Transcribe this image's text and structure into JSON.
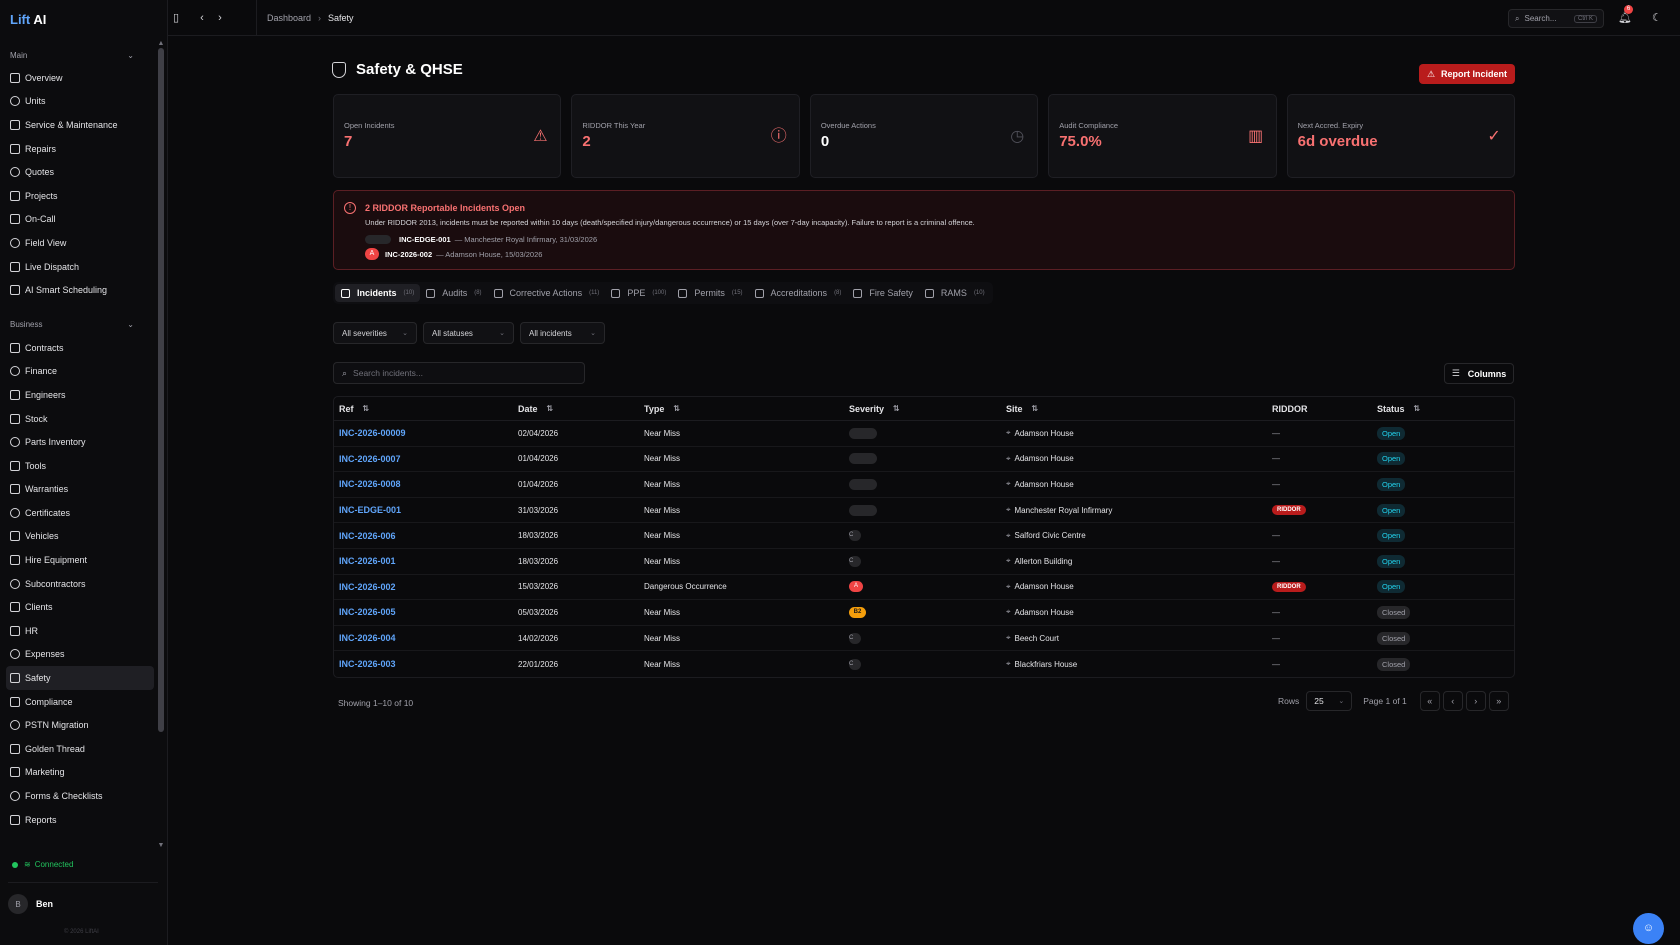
{
  "app": {
    "logo_a": "Lift",
    "logo_b": " AI"
  },
  "sidebar": {
    "main_section": "Main",
    "main_items": [
      "Overview",
      "Units",
      "Service & Maintenance",
      "Repairs",
      "Quotes",
      "Projects",
      "On-Call",
      "Field View",
      "Live Dispatch",
      "AI Smart Scheduling"
    ],
    "business_section": "Business",
    "business_items": [
      "Contracts",
      "Finance",
      "Engineers",
      "Stock",
      "Parts Inventory",
      "Tools",
      "Warranties",
      "Certificates",
      "Vehicles",
      "Hire Equipment",
      "Subcontractors",
      "Clients",
      "HR",
      "Expenses",
      "Safety",
      "Compliance",
      "PSTN Migration",
      "Golden Thread",
      "Marketing",
      "Forms & Checklists",
      "Reports"
    ],
    "active_item": "Safety",
    "connection": "Connected",
    "user_initial": "B",
    "user_name": "Ben",
    "copyright": "© 2026 LiftAI"
  },
  "topbar": {
    "breadcrumb_root": "Dashboard",
    "breadcrumb_current": "Safety",
    "search_placeholder": "Search...",
    "search_shortcut": "Ctrl K",
    "notification_count": "6"
  },
  "page": {
    "title": "Safety & QHSE",
    "report_button": "Report Incident"
  },
  "stats": [
    {
      "label": "Open Incidents",
      "value": "7",
      "accent": true,
      "icon": "warning-triangle-icon"
    },
    {
      "label": "RIDDOR This Year",
      "value": "2",
      "accent": true,
      "icon": "alert-circle-icon"
    },
    {
      "label": "Overdue Actions",
      "value": "0",
      "accent": false,
      "icon": "clock-icon"
    },
    {
      "label": "Audit Compliance",
      "value": "75.0%",
      "accent": true,
      "icon": "bar-chart-icon"
    },
    {
      "label": "Next Accred. Expiry",
      "value": "6d overdue",
      "accent": true,
      "icon": "check-circle-icon"
    }
  ],
  "alert": {
    "title": "2 RIDDOR Reportable Incidents Open",
    "text": "Under RIDDOR 2013, incidents must be reported within 10 days (death/specified injury/dangerous occurrence) or 15 days (over 7-day incapacity). Failure to report is a criminal offence.",
    "rows": [
      {
        "badge": "",
        "ref": "INC-EDGE-001",
        "detail": "— Manchester Royal Infirmary, 31/03/2026"
      },
      {
        "badge": "A",
        "ref": "INC-2026-002",
        "detail": "— Adamson House, 15/03/2026"
      }
    ]
  },
  "tabs": [
    {
      "label": "Incidents",
      "count": "(10)"
    },
    {
      "label": "Audits",
      "count": "(8)"
    },
    {
      "label": "Corrective Actions",
      "count": "(11)"
    },
    {
      "label": "PPE",
      "count": "(100)"
    },
    {
      "label": "Permits",
      "count": "(15)"
    },
    {
      "label": "Accreditations",
      "count": "(8)"
    },
    {
      "label": "Fire Safety",
      "count": ""
    },
    {
      "label": "RAMS",
      "count": "(10)"
    }
  ],
  "filters": [
    "All severities",
    "All statuses",
    "All incidents"
  ],
  "search": {
    "placeholder": "Search incidents..."
  },
  "columns_button": "Columns",
  "table": {
    "headers": {
      "ref": "Ref",
      "date": "Date",
      "type": "Type",
      "severity": "Severity",
      "site": "Site",
      "riddor": "RIDDOR",
      "status": "Status"
    },
    "rows": [
      {
        "ref": "INC-2026-00009",
        "date": "02/04/2026",
        "type": "Near Miss",
        "sev": "",
        "site": "Adamson House",
        "riddor": "—",
        "status": "Open"
      },
      {
        "ref": "INC-2026-0007",
        "date": "01/04/2026",
        "type": "Near Miss",
        "sev": "",
        "site": "Adamson House",
        "riddor": "—",
        "status": "Open"
      },
      {
        "ref": "INC-2026-0008",
        "date": "01/04/2026",
        "type": "Near Miss",
        "sev": "",
        "site": "Adamson House",
        "riddor": "—",
        "status": "Open"
      },
      {
        "ref": "INC-EDGE-001",
        "date": "31/03/2026",
        "type": "Near Miss",
        "sev": "",
        "site": "Manchester Royal Infirmary",
        "riddor": "RIDDOR",
        "status": "Open"
      },
      {
        "ref": "INC-2026-006",
        "date": "18/03/2026",
        "type": "Near Miss",
        "sev": "C",
        "site": "Salford Civic Centre",
        "riddor": "—",
        "status": "Open"
      },
      {
        "ref": "INC-2026-001",
        "date": "18/03/2026",
        "type": "Near Miss",
        "sev": "C",
        "site": "Allerton Building",
        "riddor": "—",
        "status": "Open"
      },
      {
        "ref": "INC-2026-002",
        "date": "15/03/2026",
        "type": "Dangerous Occurrence",
        "sev": "A",
        "site": "Adamson House",
        "riddor": "RIDDOR",
        "status": "Open"
      },
      {
        "ref": "INC-2026-005",
        "date": "05/03/2026",
        "type": "Near Miss",
        "sev": "B2",
        "site": "Adamson House",
        "riddor": "—",
        "status": "Closed"
      },
      {
        "ref": "INC-2026-004",
        "date": "14/02/2026",
        "type": "Near Miss",
        "sev": "C",
        "site": "Beech Court",
        "riddor": "—",
        "status": "Closed"
      },
      {
        "ref": "INC-2026-003",
        "date": "22/01/2026",
        "type": "Near Miss",
        "sev": "C",
        "site": "Blackfriars House",
        "riddor": "—",
        "status": "Closed"
      }
    ]
  },
  "footer": {
    "showing": "Showing 1–10 of 10",
    "rows_label": "Rows",
    "rows_value": "25",
    "page_label": "Page 1 of 1"
  },
  "colors": {
    "accent_red": "#f87171",
    "link_blue": "#60a5fa",
    "open_cyan": "#22d3ee",
    "connected_green": "#22c55e"
  }
}
